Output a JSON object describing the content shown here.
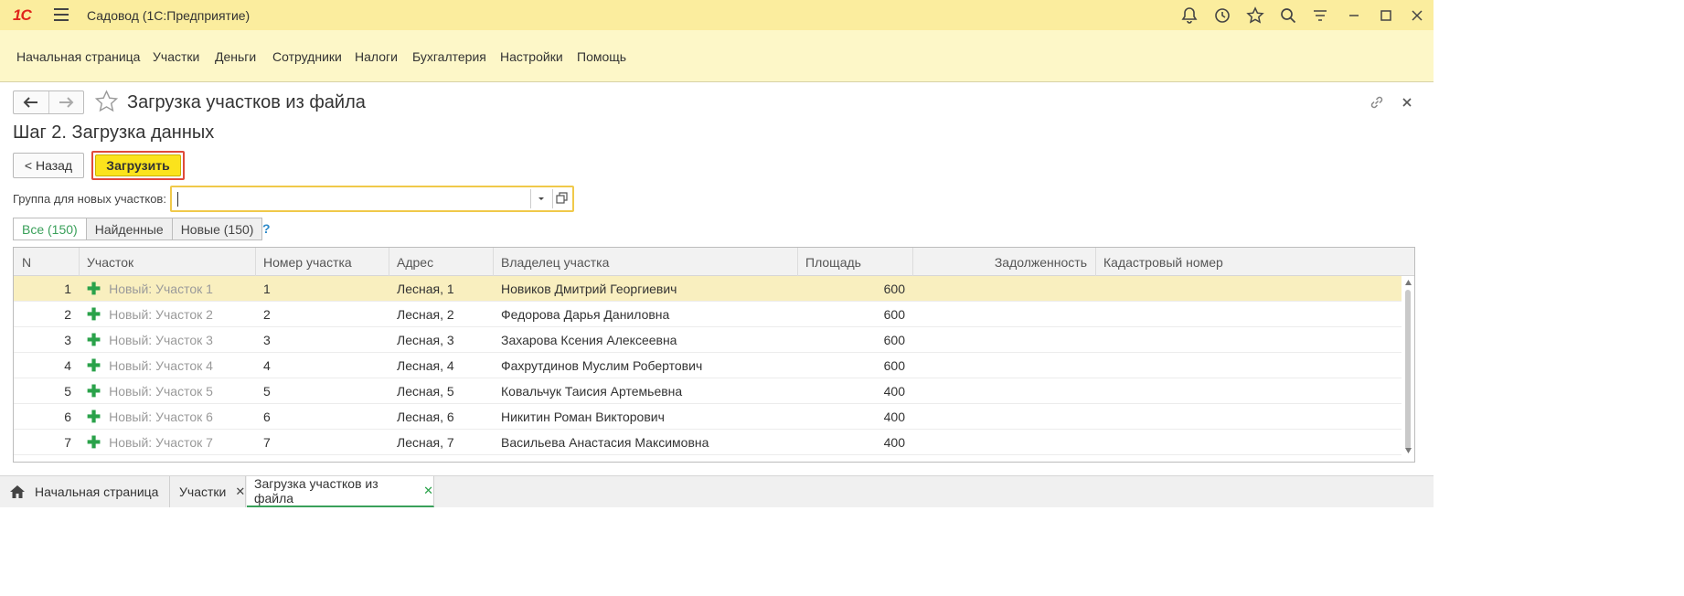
{
  "titlebar": {
    "logo": "1С",
    "app_title": "Садовод  (1С:Предприятие)",
    "icons": [
      "bell-icon",
      "history-icon",
      "star-icon",
      "search-icon",
      "menu-settings-icon",
      "minimize-icon",
      "maximize-icon",
      "close-icon"
    ]
  },
  "sections": [
    "Начальная страница",
    "Участки",
    "Деньги",
    "Сотрудники",
    "Налоги",
    "Бухгалтерия",
    "Настройки",
    "Помощь"
  ],
  "form": {
    "title": "Загрузка участков из файла",
    "step_title": "Шаг 2. Загрузка данных",
    "back_label": "< Назад",
    "load_label": "Загрузить",
    "group_label": "Группа для новых участков:",
    "group_value": ""
  },
  "filter_tabs": [
    "Все (150)",
    "Найденные",
    "Новые (150)"
  ],
  "help": "?",
  "table": {
    "columns": [
      "N",
      "Участок",
      "Номер участка",
      "Адрес",
      "Владелец участка",
      "Площадь",
      "Задолженность",
      "Кадастровый номер"
    ],
    "rows": [
      {
        "n": "1",
        "plot": "Новый: Участок 1",
        "number": "1",
        "address": "Лесная, 1",
        "owner": "Новиков Дмитрий Георгиевич",
        "area": "600",
        "debt": "",
        "cadastral": ""
      },
      {
        "n": "2",
        "plot": "Новый: Участок 2",
        "number": "2",
        "address": "Лесная, 2",
        "owner": "Федорова Дарья Даниловна",
        "area": "600",
        "debt": "",
        "cadastral": ""
      },
      {
        "n": "3",
        "plot": "Новый: Участок 3",
        "number": "3",
        "address": "Лесная, 3",
        "owner": "Захарова Ксения Алексеевна",
        "area": "600",
        "debt": "",
        "cadastral": ""
      },
      {
        "n": "4",
        "plot": "Новый: Участок 4",
        "number": "4",
        "address": "Лесная, 4",
        "owner": "Фахрутдинов Муслим Робертович",
        "area": "600",
        "debt": "",
        "cadastral": ""
      },
      {
        "n": "5",
        "plot": "Новый: Участок 5",
        "number": "5",
        "address": "Лесная, 5",
        "owner": "Ковальчук Таисия Артемьевна",
        "area": "400",
        "debt": "",
        "cadastral": ""
      },
      {
        "n": "6",
        "plot": "Новый: Участок 6",
        "number": "6",
        "address": "Лесная, 6",
        "owner": "Никитин Роман Викторович",
        "area": "400",
        "debt": "",
        "cadastral": ""
      },
      {
        "n": "7",
        "plot": "Новый: Участок 7",
        "number": "7",
        "address": "Лесная, 7",
        "owner": "Васильева Анастасия Максимовна",
        "area": "400",
        "debt": "",
        "cadastral": ""
      }
    ],
    "selected_row": 0
  },
  "open_tabs": [
    "Начальная страница",
    "Участки",
    "Загрузка участков из файла"
  ],
  "colors": {
    "titlebar": "#fbed9e",
    "sections": "#fdf7c8",
    "accent": "#fbe31c",
    "highlight": "#e04a3a",
    "green": "#2aa24a"
  }
}
